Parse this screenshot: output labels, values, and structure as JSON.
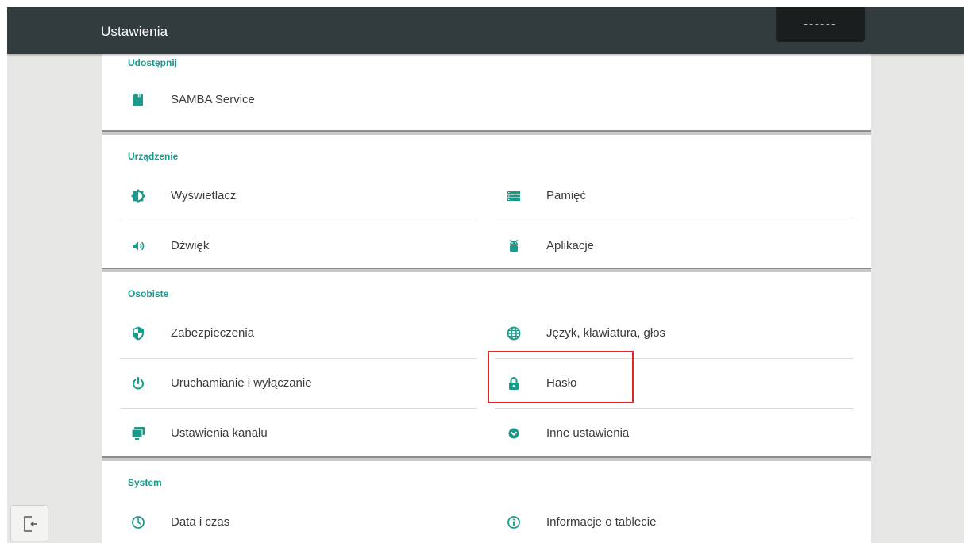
{
  "topbar": {
    "title": "Ustawienia",
    "status_text": "------"
  },
  "sections": {
    "share": {
      "title": "Udostępnij",
      "items": [
        {
          "label": "SAMBA Service",
          "icon": "sd-card-icon"
        }
      ]
    },
    "device": {
      "title": "Urządzenie",
      "items": [
        {
          "label": "Wyświetlacz",
          "icon": "brightness-icon"
        },
        {
          "label": "Pamięć",
          "icon": "storage-icon"
        },
        {
          "label": "Dźwięk",
          "icon": "volume-icon"
        },
        {
          "label": "Aplikacje",
          "icon": "android-icon"
        }
      ]
    },
    "personal": {
      "title": "Osobiste",
      "items": [
        {
          "label": "Zabezpieczenia",
          "icon": "shield-icon"
        },
        {
          "label": "Język, klawiatura, głos",
          "icon": "globe-icon"
        },
        {
          "label": "Uruchamianie i wyłączanie",
          "icon": "power-icon"
        },
        {
          "label": "Hasło",
          "icon": "lock-icon"
        },
        {
          "label": "Ustawienia kanału",
          "icon": "monitor-icon"
        },
        {
          "label": "Inne ustawienia",
          "icon": "chevron-circle-icon"
        }
      ]
    },
    "system": {
      "title": "System",
      "items": [
        {
          "label": "Data i czas",
          "icon": "clock-icon"
        },
        {
          "label": "Informacje o tablecie",
          "icon": "info-icon"
        }
      ]
    }
  },
  "colors": {
    "accent": "#1a9a8a",
    "topbar": "#323b3d",
    "highlight": "#e02727",
    "background": "#e6e6e4"
  },
  "exit_button": {
    "icon": "exit-icon"
  }
}
